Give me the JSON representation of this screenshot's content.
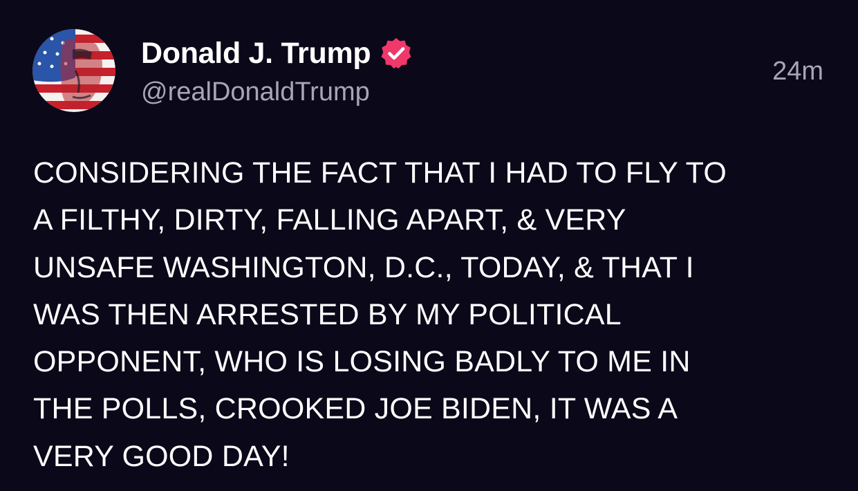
{
  "post": {
    "author": {
      "display_name": "Donald J. Trump",
      "handle": "@realDonaldTrump",
      "verified_icon": "verified-badge-icon",
      "avatar": "flag-painted-portrait"
    },
    "timestamp": "24m",
    "body_lines": [
      "CONSIDERING THE FACT THAT I HAD TO FLY TO",
      "A FILTHY, DIRTY, FALLING APART, & VERY",
      "UNSAFE WASHINGTON, D.C., TODAY, & THAT I",
      "WAS THEN ARRESTED BY MY POLITICAL",
      "OPPONENT, WHO IS LOSING BADLY TO ME IN",
      "THE POLLS, CROOKED JOE BIDEN, IT WAS A",
      "VERY GOOD DAY!"
    ]
  },
  "colors": {
    "background": "#0b0819",
    "text": "#ffffff",
    "secondary_text": "#a9a5b4",
    "verified_badge": "#f0386b"
  }
}
